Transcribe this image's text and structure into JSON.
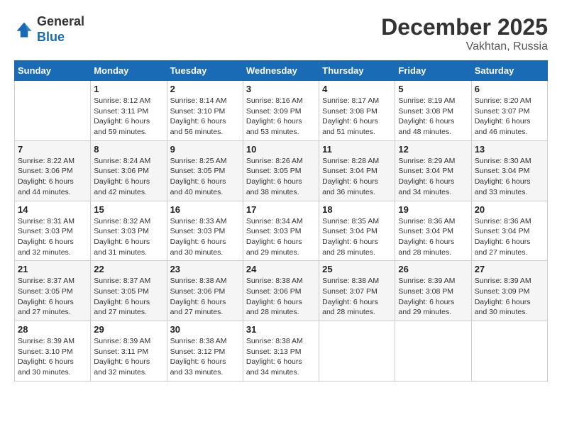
{
  "header": {
    "logo_general": "General",
    "logo_blue": "Blue",
    "month": "December 2025",
    "location": "Vakhtan, Russia"
  },
  "days_of_week": [
    "Sunday",
    "Monday",
    "Tuesday",
    "Wednesday",
    "Thursday",
    "Friday",
    "Saturday"
  ],
  "weeks": [
    [
      {
        "day": "",
        "sunrise": "",
        "sunset": "",
        "daylight": ""
      },
      {
        "day": "1",
        "sunrise": "Sunrise: 8:12 AM",
        "sunset": "Sunset: 3:11 PM",
        "daylight": "Daylight: 6 hours and 59 minutes."
      },
      {
        "day": "2",
        "sunrise": "Sunrise: 8:14 AM",
        "sunset": "Sunset: 3:10 PM",
        "daylight": "Daylight: 6 hours and 56 minutes."
      },
      {
        "day": "3",
        "sunrise": "Sunrise: 8:16 AM",
        "sunset": "Sunset: 3:09 PM",
        "daylight": "Daylight: 6 hours and 53 minutes."
      },
      {
        "day": "4",
        "sunrise": "Sunrise: 8:17 AM",
        "sunset": "Sunset: 3:08 PM",
        "daylight": "Daylight: 6 hours and 51 minutes."
      },
      {
        "day": "5",
        "sunrise": "Sunrise: 8:19 AM",
        "sunset": "Sunset: 3:08 PM",
        "daylight": "Daylight: 6 hours and 48 minutes."
      },
      {
        "day": "6",
        "sunrise": "Sunrise: 8:20 AM",
        "sunset": "Sunset: 3:07 PM",
        "daylight": "Daylight: 6 hours and 46 minutes."
      }
    ],
    [
      {
        "day": "7",
        "sunrise": "Sunrise: 8:22 AM",
        "sunset": "Sunset: 3:06 PM",
        "daylight": "Daylight: 6 hours and 44 minutes."
      },
      {
        "day": "8",
        "sunrise": "Sunrise: 8:24 AM",
        "sunset": "Sunset: 3:06 PM",
        "daylight": "Daylight: 6 hours and 42 minutes."
      },
      {
        "day": "9",
        "sunrise": "Sunrise: 8:25 AM",
        "sunset": "Sunset: 3:05 PM",
        "daylight": "Daylight: 6 hours and 40 minutes."
      },
      {
        "day": "10",
        "sunrise": "Sunrise: 8:26 AM",
        "sunset": "Sunset: 3:05 PM",
        "daylight": "Daylight: 6 hours and 38 minutes."
      },
      {
        "day": "11",
        "sunrise": "Sunrise: 8:28 AM",
        "sunset": "Sunset: 3:04 PM",
        "daylight": "Daylight: 6 hours and 36 minutes."
      },
      {
        "day": "12",
        "sunrise": "Sunrise: 8:29 AM",
        "sunset": "Sunset: 3:04 PM",
        "daylight": "Daylight: 6 hours and 34 minutes."
      },
      {
        "day": "13",
        "sunrise": "Sunrise: 8:30 AM",
        "sunset": "Sunset: 3:04 PM",
        "daylight": "Daylight: 6 hours and 33 minutes."
      }
    ],
    [
      {
        "day": "14",
        "sunrise": "Sunrise: 8:31 AM",
        "sunset": "Sunset: 3:03 PM",
        "daylight": "Daylight: 6 hours and 32 minutes."
      },
      {
        "day": "15",
        "sunrise": "Sunrise: 8:32 AM",
        "sunset": "Sunset: 3:03 PM",
        "daylight": "Daylight: 6 hours and 31 minutes."
      },
      {
        "day": "16",
        "sunrise": "Sunrise: 8:33 AM",
        "sunset": "Sunset: 3:03 PM",
        "daylight": "Daylight: 6 hours and 30 minutes."
      },
      {
        "day": "17",
        "sunrise": "Sunrise: 8:34 AM",
        "sunset": "Sunset: 3:03 PM",
        "daylight": "Daylight: 6 hours and 29 minutes."
      },
      {
        "day": "18",
        "sunrise": "Sunrise: 8:35 AM",
        "sunset": "Sunset: 3:04 PM",
        "daylight": "Daylight: 6 hours and 28 minutes."
      },
      {
        "day": "19",
        "sunrise": "Sunrise: 8:36 AM",
        "sunset": "Sunset: 3:04 PM",
        "daylight": "Daylight: 6 hours and 28 minutes."
      },
      {
        "day": "20",
        "sunrise": "Sunrise: 8:36 AM",
        "sunset": "Sunset: 3:04 PM",
        "daylight": "Daylight: 6 hours and 27 minutes."
      }
    ],
    [
      {
        "day": "21",
        "sunrise": "Sunrise: 8:37 AM",
        "sunset": "Sunset: 3:05 PM",
        "daylight": "Daylight: 6 hours and 27 minutes."
      },
      {
        "day": "22",
        "sunrise": "Sunrise: 8:37 AM",
        "sunset": "Sunset: 3:05 PM",
        "daylight": "Daylight: 6 hours and 27 minutes."
      },
      {
        "day": "23",
        "sunrise": "Sunrise: 8:38 AM",
        "sunset": "Sunset: 3:06 PM",
        "daylight": "Daylight: 6 hours and 27 minutes."
      },
      {
        "day": "24",
        "sunrise": "Sunrise: 8:38 AM",
        "sunset": "Sunset: 3:06 PM",
        "daylight": "Daylight: 6 hours and 28 minutes."
      },
      {
        "day": "25",
        "sunrise": "Sunrise: 8:38 AM",
        "sunset": "Sunset: 3:07 PM",
        "daylight": "Daylight: 6 hours and 28 minutes."
      },
      {
        "day": "26",
        "sunrise": "Sunrise: 8:39 AM",
        "sunset": "Sunset: 3:08 PM",
        "daylight": "Daylight: 6 hours and 29 minutes."
      },
      {
        "day": "27",
        "sunrise": "Sunrise: 8:39 AM",
        "sunset": "Sunset: 3:09 PM",
        "daylight": "Daylight: 6 hours and 30 minutes."
      }
    ],
    [
      {
        "day": "28",
        "sunrise": "Sunrise: 8:39 AM",
        "sunset": "Sunset: 3:10 PM",
        "daylight": "Daylight: 6 hours and 30 minutes."
      },
      {
        "day": "29",
        "sunrise": "Sunrise: 8:39 AM",
        "sunset": "Sunset: 3:11 PM",
        "daylight": "Daylight: 6 hours and 32 minutes."
      },
      {
        "day": "30",
        "sunrise": "Sunrise: 8:38 AM",
        "sunset": "Sunset: 3:12 PM",
        "daylight": "Daylight: 6 hours and 33 minutes."
      },
      {
        "day": "31",
        "sunrise": "Sunrise: 8:38 AM",
        "sunset": "Sunset: 3:13 PM",
        "daylight": "Daylight: 6 hours and 34 minutes."
      },
      {
        "day": "",
        "sunrise": "",
        "sunset": "",
        "daylight": ""
      },
      {
        "day": "",
        "sunrise": "",
        "sunset": "",
        "daylight": ""
      },
      {
        "day": "",
        "sunrise": "",
        "sunset": "",
        "daylight": ""
      }
    ]
  ]
}
